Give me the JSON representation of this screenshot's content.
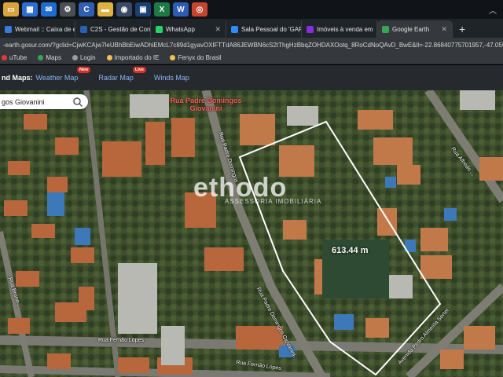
{
  "taskbar": {
    "icons": [
      {
        "name": "file-explorer-icon",
        "color": "#d8a33a",
        "glyph": "▭"
      },
      {
        "name": "calendar-icon",
        "color": "#2b6fd6",
        "glyph": "▦"
      },
      {
        "name": "mail-icon",
        "color": "#1e6bd1",
        "glyph": "✉"
      },
      {
        "name": "settings-icon",
        "color": "#4a4f55",
        "glyph": "⚙"
      },
      {
        "name": "app-c-icon",
        "color": "#2f5fb5",
        "glyph": "C"
      },
      {
        "name": "folder-icon",
        "color": "#e0b341",
        "glyph": "▬"
      },
      {
        "name": "app-lens-icon",
        "color": "#3a4a66",
        "glyph": "◉"
      },
      {
        "name": "app-tv-icon",
        "color": "#1a3f73",
        "glyph": "▣"
      },
      {
        "name": "excel-icon",
        "color": "#1d7a45",
        "glyph": "X"
      },
      {
        "name": "word-icon",
        "color": "#2c5cb6",
        "glyph": "W"
      },
      {
        "name": "chrome-icon",
        "color": "#c7442f",
        "glyph": "◎"
      }
    ]
  },
  "tabs": [
    {
      "label": "Webmail :: Caixa de e",
      "color": "#3a7bd5",
      "active": false
    },
    {
      "label": "C2S - Gestão de Con",
      "color": "#2c5fb0",
      "active": false
    },
    {
      "label": "WhatsApp",
      "color": "#25d366",
      "active": false
    },
    {
      "label": "Sala Pessoal do 'GAR",
      "color": "#2d8cff",
      "active": false
    },
    {
      "label": "Imóveis à venda em",
      "color": "#8b2be2",
      "active": false
    },
    {
      "label": "Google Earth",
      "color": "#34a853",
      "active": true
    }
  ],
  "address": {
    "url": "-earth.gosur.com/?gclid=CjwKCAjw7leUBhBbEiwADhiEMcL7c89d1gyavOXlFTTdA86JEWBN6cS2tThgHzBbqZOHDAXOotq_8RoCdNoQAvD_BwE&ll=-22.86840775701957,-47.059..."
  },
  "bookmarks": [
    {
      "label": "uTube",
      "color": "#e53935"
    },
    {
      "label": "Maps",
      "color": "#34a853"
    },
    {
      "label": "Login",
      "color": "#9e9e9e"
    },
    {
      "label": "Importado do IE",
      "color": "#f2c14e"
    },
    {
      "label": "Fenyx do Brasil",
      "color": "#f2c14e"
    }
  ],
  "gearth_bar": {
    "brand": "nd Maps:",
    "weather": "Weather Map",
    "weather_badge": "New",
    "radar": "Radar Map",
    "radar_badge": "Live",
    "winds": "Winds Map"
  },
  "search": {
    "value": "gos Giovanini"
  },
  "map": {
    "pin_label": "Rua Padre Domingos Giovanini",
    "measurement": "613.44 m",
    "streets": {
      "fernao_lopes": "Rua Fernão Lopes",
      "fernao_lopes_2": "Rua Fernão Lopes",
      "padre_domingos": "Rua Padre Domingos Giovanini",
      "padre_domingos_top": "Rua Padre Domingos",
      "bruno_left": "Rua Bruno ...",
      "pedro_almeida": "Avenida Pedro Almeida Sertel",
      "alfredo": "Rua Alfredo ...",
      "right_street": "Rua Ab..."
    },
    "watermark": "ethodo",
    "watermark_sub": "ASSESSORIA IMOBILIÁRIA"
  }
}
